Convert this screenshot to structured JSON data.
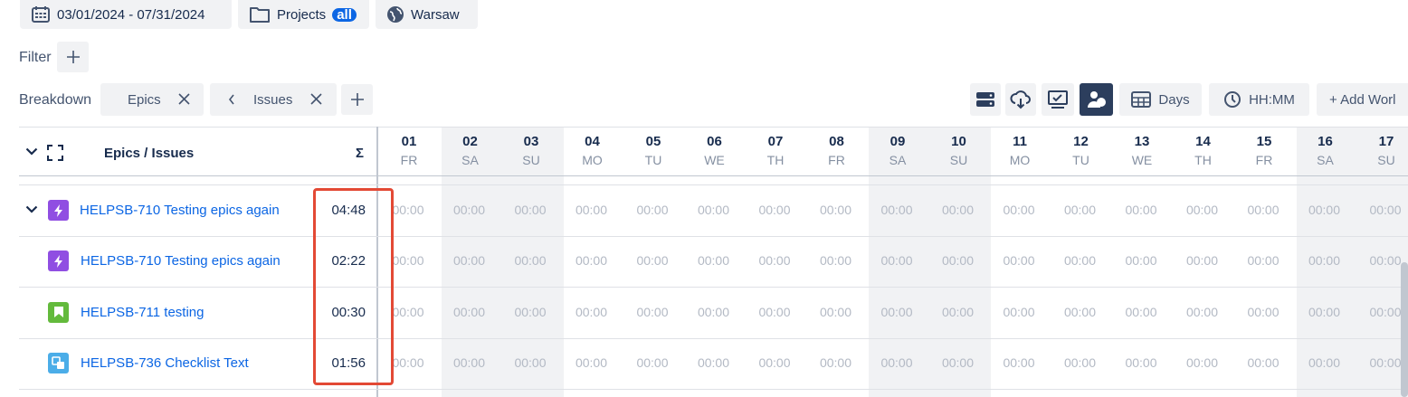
{
  "toolbar": {
    "date_range": "03/01/2024 - 07/31/2024",
    "projects_label": "Projects",
    "projects_badge": "all",
    "timezone": "Warsaw"
  },
  "filter": {
    "label": "Filter"
  },
  "breakdown": {
    "label": "Breakdown",
    "chips": [
      {
        "label": "Epics"
      },
      {
        "label": "Issues"
      }
    ]
  },
  "view_controls": {
    "period_label": "Days",
    "format_label": "HH:MM",
    "add_label": "+ Add Worl"
  },
  "grid": {
    "column_header": "Epics / Issues",
    "sum_symbol": "Σ",
    "days": [
      {
        "num": "01",
        "wd": "FR",
        "weekend": false
      },
      {
        "num": "02",
        "wd": "SA",
        "weekend": true
      },
      {
        "num": "03",
        "wd": "SU",
        "weekend": true
      },
      {
        "num": "04",
        "wd": "MO",
        "weekend": false
      },
      {
        "num": "05",
        "wd": "TU",
        "weekend": false
      },
      {
        "num": "06",
        "wd": "WE",
        "weekend": false
      },
      {
        "num": "07",
        "wd": "TH",
        "weekend": false
      },
      {
        "num": "08",
        "wd": "FR",
        "weekend": false
      },
      {
        "num": "09",
        "wd": "SA",
        "weekend": true
      },
      {
        "num": "10",
        "wd": "SU",
        "weekend": true
      },
      {
        "num": "11",
        "wd": "MO",
        "weekend": false
      },
      {
        "num": "12",
        "wd": "TU",
        "weekend": false
      },
      {
        "num": "13",
        "wd": "WE",
        "weekend": false
      },
      {
        "num": "14",
        "wd": "TH",
        "weekend": false
      },
      {
        "num": "15",
        "wd": "FR",
        "weekend": false
      },
      {
        "num": "16",
        "wd": "SA",
        "weekend": true
      },
      {
        "num": "17",
        "wd": "SU",
        "weekend": true
      }
    ],
    "empty_cell": "00:00",
    "rows": [
      {
        "title": "HELPSB-710 Testing epics again",
        "total": "04:48",
        "type": "epic",
        "expandable": true
      },
      {
        "title": "HELPSB-710 Testing epics again",
        "total": "02:22",
        "type": "epic",
        "expandable": false
      },
      {
        "title": "HELPSB-711 testing",
        "total": "00:30",
        "type": "story",
        "expandable": false
      },
      {
        "title": "HELPSB-736 Checklist Text",
        "total": "01:56",
        "type": "subtask",
        "expandable": false
      }
    ]
  },
  "colors": {
    "epic": "#904ee2",
    "story": "#63ba3c",
    "subtask": "#4bade8",
    "link": "#0c66e4",
    "highlight": "#e34935",
    "active_button": "#2c3e5d"
  }
}
